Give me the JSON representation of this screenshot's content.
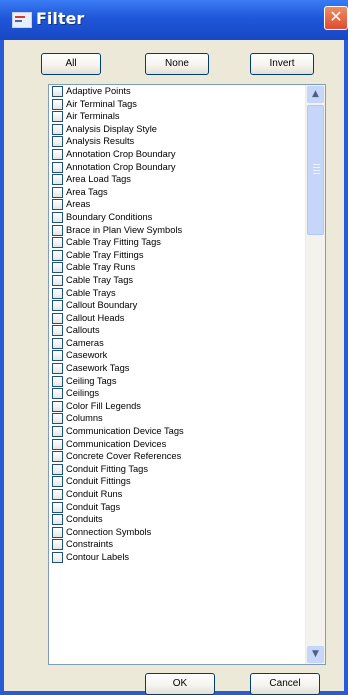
{
  "window": {
    "title": "Filter",
    "close_symbol": "✕"
  },
  "buttons": {
    "all": "All",
    "none": "None",
    "invert": "Invert",
    "ok": "OK",
    "cancel": "Cancel"
  },
  "list": {
    "items": [
      {
        "label": "Adaptive Points",
        "checked": false
      },
      {
        "label": "Air Terminal Tags",
        "checked": false
      },
      {
        "label": "Air Terminals",
        "checked": false
      },
      {
        "label": "Analysis Display Style",
        "checked": false
      },
      {
        "label": "Analysis Results",
        "checked": false
      },
      {
        "label": "Annotation Crop Boundary",
        "checked": false
      },
      {
        "label": "Annotation Crop Boundary",
        "checked": false
      },
      {
        "label": "Area Load Tags",
        "checked": false
      },
      {
        "label": "Area Tags",
        "checked": false
      },
      {
        "label": "Areas",
        "checked": false
      },
      {
        "label": "Boundary Conditions",
        "checked": false
      },
      {
        "label": "Brace in Plan View Symbols",
        "checked": false
      },
      {
        "label": "Cable Tray Fitting Tags",
        "checked": false
      },
      {
        "label": "Cable Tray Fittings",
        "checked": false
      },
      {
        "label": "Cable Tray Runs",
        "checked": false
      },
      {
        "label": "Cable Tray Tags",
        "checked": false
      },
      {
        "label": "Cable Trays",
        "checked": false
      },
      {
        "label": "Callout Boundary",
        "checked": false
      },
      {
        "label": "Callout Heads",
        "checked": false
      },
      {
        "label": "Callouts",
        "checked": false
      },
      {
        "label": "Cameras",
        "checked": false
      },
      {
        "label": "Casework",
        "checked": false
      },
      {
        "label": "Casework Tags",
        "checked": false
      },
      {
        "label": "Ceiling Tags",
        "checked": false
      },
      {
        "label": "Ceilings",
        "checked": false
      },
      {
        "label": "Color Fill Legends",
        "checked": false
      },
      {
        "label": "Columns",
        "checked": false
      },
      {
        "label": "Communication Device Tags",
        "checked": false
      },
      {
        "label": "Communication Devices",
        "checked": false
      },
      {
        "label": "Concrete Cover References",
        "checked": false
      },
      {
        "label": "Conduit Fitting Tags",
        "checked": false
      },
      {
        "label": "Conduit Fittings",
        "checked": false
      },
      {
        "label": "Conduit Runs",
        "checked": false
      },
      {
        "label": "Conduit Tags",
        "checked": false
      },
      {
        "label": "Conduits",
        "checked": false
      },
      {
        "label": "Connection Symbols",
        "checked": false
      },
      {
        "label": "Constraints",
        "checked": false
      },
      {
        "label": "Contour Labels",
        "checked": false
      }
    ]
  },
  "scrollbar": {
    "up_arrow": "▲",
    "down_arrow": "▼",
    "position": 0.0
  },
  "colors": {
    "title_bar": "#1f57d8",
    "dialog_bg": "#ece9d8",
    "close_button": "#df4d2c",
    "list_border": "#7f9db9",
    "scrollbar_thumb": "#c6d6fb"
  }
}
